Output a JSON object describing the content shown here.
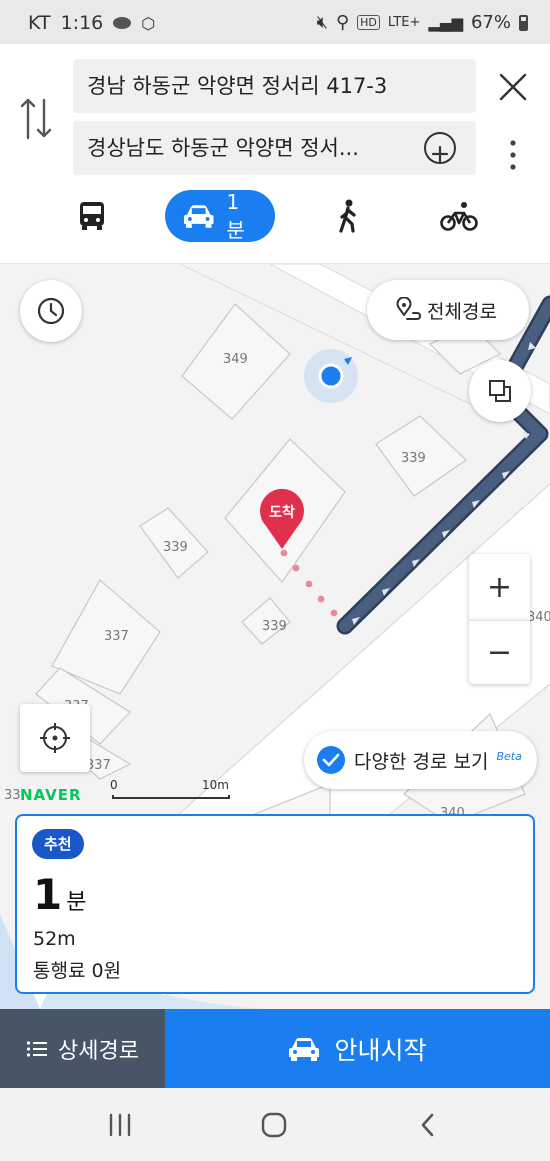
{
  "status": {
    "carrier": "KT",
    "time": "1:16",
    "network": "LTE+",
    "battery": "67%"
  },
  "header": {
    "origin": "경남 하동군 악양면 정서리 417-3",
    "destination": "경상남도 하동군 악양면 정서...",
    "modes": [
      {
        "name": "bus-icon",
        "active": false
      },
      {
        "name": "car-icon",
        "active": true,
        "duration": "1분"
      },
      {
        "name": "walk-icon",
        "active": false
      },
      {
        "name": "bike-icon",
        "active": false
      }
    ]
  },
  "map": {
    "full_route_label": "전체경로",
    "arrival_label": "도착",
    "alt_routes_label": "다양한 경로 보기",
    "alt_routes_badge": "Beta",
    "logo": "NAVER",
    "scale_start": "0",
    "scale_end": "10m",
    "zoom_in": "+",
    "zoom_out": "−",
    "building_numbers": [
      "349",
      "339",
      "339",
      "339",
      "337",
      "337",
      "337",
      "340",
      "340",
      "33"
    ]
  },
  "route_card": {
    "badge": "추천",
    "duration_value": "1",
    "duration_unit": "분",
    "distance": "52m",
    "toll": "통행료 0원"
  },
  "actions": {
    "detail_label": "상세경로",
    "start_label": "안내시작"
  },
  "colors": {
    "accent": "#1a7ef0",
    "route": "#4a5f80",
    "arrival_pin": "#e0304e",
    "detail_bg": "#475566"
  }
}
